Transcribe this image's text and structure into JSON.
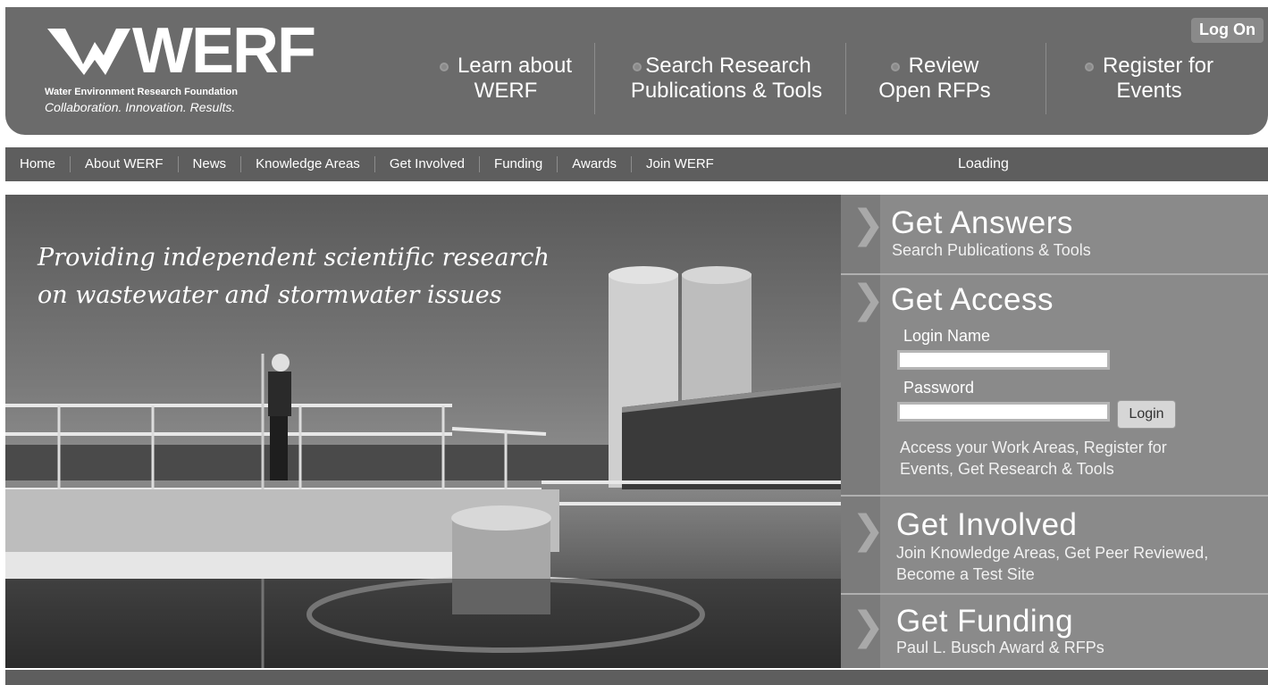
{
  "header": {
    "logo_wordmark": "WERF",
    "org_name": "Water Environment Research Foundation",
    "tagline": "Collaboration. Innovation. Results.",
    "logon_label": "Log On",
    "top_nav": [
      {
        "line1": "Learn about",
        "line2": "WERF"
      },
      {
        "line1": "Search Research",
        "line2": "Publications & Tools"
      },
      {
        "line1": "Review",
        "line2": "Open RFPs"
      },
      {
        "line1": "Register for",
        "line2": "Events"
      }
    ]
  },
  "menu": {
    "items": [
      "Home",
      "About WERF",
      "News",
      "Knowledge Areas",
      "Get Involved",
      "Funding",
      "Awards",
      "Join WERF"
    ],
    "status": "Loading"
  },
  "hero": {
    "line1": "Providing independent scientific research",
    "line2": "on wastewater and stormwater issues"
  },
  "panel": {
    "answers": {
      "title": "Get Answers",
      "subtitle": "Search Publications & Tools"
    },
    "access": {
      "title": "Get Access",
      "login_label": "Login Name",
      "password_label": "Password",
      "login_button": "Login",
      "desc_line1": "Access your Work Areas, Register for",
      "desc_line2": "Events, Get Research & Tools"
    },
    "involved": {
      "title": "Get Involved",
      "line1": "Join Knowledge Areas, Get Peer Reviewed,",
      "line2": "Become a Test Site"
    },
    "funding": {
      "title": "Get Funding",
      "subtitle": "Paul L. Busch Award & RFPs"
    }
  },
  "colors": {
    "header_bg": "#6b6b6b",
    "menu_bg": "#5e5e5e",
    "panel_bg": "#8a8a8a"
  }
}
